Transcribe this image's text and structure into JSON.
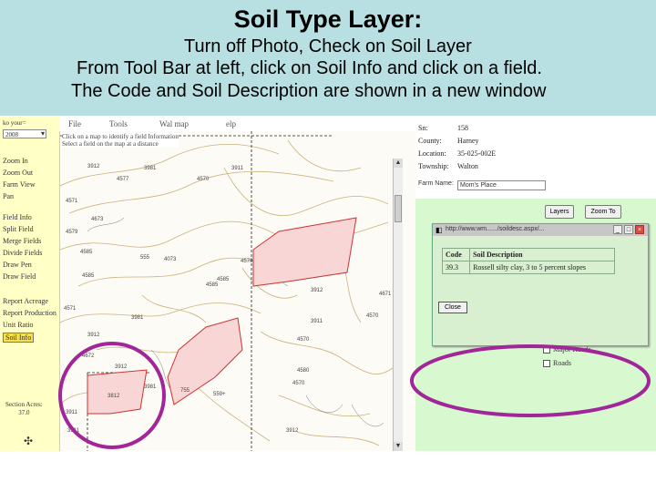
{
  "slide": {
    "title": "Soil Type Layer:",
    "line1": "Turn off Photo, Check on Soil Layer",
    "line2": "From Tool Bar at left, click on Soil Info and click on a field.",
    "line3": "The Code and Soil Description are shown in a new window"
  },
  "menu": {
    "file": "File",
    "tools": "Tools",
    "wal_map": "Wal map",
    "help": "elp"
  },
  "sidebar": {
    "year_label": "ko your=",
    "year_value": "2008",
    "tools": [
      "Zoom In",
      "Zoom Out",
      "Farm View",
      "Pan",
      "Field Info",
      "Split Field",
      "Merge Fields",
      "Divide Fields",
      "Draw Pen",
      "Draw Field",
      "Report Acreage",
      "Report Production",
      "Unit Ratio",
      "Soil Info"
    ],
    "acres_label": "Section Acres:",
    "acres_value": "37.0"
  },
  "map": {
    "message_line1": "Click on a map to identify a field Information",
    "message_line2": "Select a field on the map at a distance",
    "labels": [
      "3912",
      "3981",
      "3911",
      "4577",
      "4570",
      "4571",
      "4673",
      "4579",
      "4585",
      "555",
      "4073",
      "4570",
      "4585",
      "3912",
      "3911",
      "4570",
      "4571",
      "4672",
      "3812",
      "3981",
      "755",
      "559+",
      "4580",
      "4570",
      "3911",
      "3912",
      "4570",
      "3981",
      "3912",
      "4585",
      "4671",
      "3912",
      "4585",
      "3911"
    ]
  },
  "info": {
    "sn_label": "Sn:",
    "sn_value": "158",
    "county_label": "County:",
    "county_value": "Harney",
    "location_label": "Location:",
    "location_value": "35-025-002E",
    "township_label": "Township:",
    "township_value": "Walton",
    "farm_name_label": "Farm Name:",
    "farm_name_value": "Mom's Place",
    "layers_button": "Layers",
    "zoom_button": "Zoom To"
  },
  "popup": {
    "url": "http://www.wm....../soildesc.aspx/...",
    "col_code": "Code",
    "col_desc": "Soil Description",
    "code": "39.3",
    "description": "Rossell silty clay, 3 to 5 percent slopes",
    "close_label": "Close"
  },
  "checks": {
    "major_roads": "Major Roads",
    "roads": "Roads"
  },
  "colors": {
    "header_bg": "#b8dfe2",
    "sidebar_bg": "#ffffc6",
    "panel_green": "#d8f8cf",
    "highlight_circle": "#a0269a",
    "field_fill": "#f9d6d6"
  }
}
